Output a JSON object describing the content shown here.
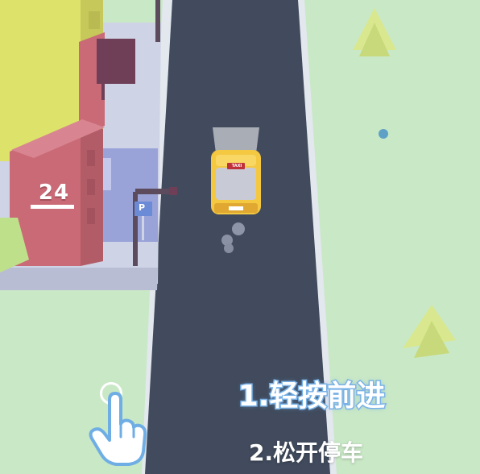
{
  "building": {
    "number": "24"
  },
  "parking_sign": {
    "letter": "P"
  },
  "taxi": {
    "roof_sign": "TAXI"
  },
  "instructions": {
    "step1": "1.轻按前进",
    "step2": "2.松开停车"
  },
  "colors": {
    "grass": "#c9e8c6",
    "road": "#414b5d",
    "taxi": "#f5c842",
    "building_pink": "#c96a76",
    "building_yellow": "#dde26a",
    "instruction_outline": "#7fb6e8"
  },
  "icons": {
    "hand": "tap-hand-icon",
    "ring": "tap-ring-icon"
  }
}
